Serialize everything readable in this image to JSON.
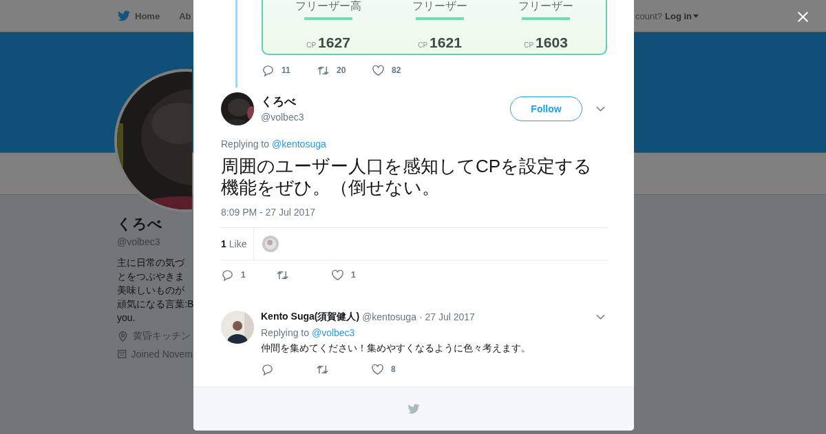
{
  "nav": {
    "items": [
      {
        "label": "Home",
        "kind": "home"
      },
      {
        "label": "Ab",
        "kind": "plain"
      }
    ],
    "account_text": "count?",
    "login": "Log in"
  },
  "profile": {
    "name": "くろべ",
    "handle": "@volbec3",
    "bio": [
      "主に日常の気づ",
      "とをつぶやきま",
      "美味しいものが",
      "頑気になる言葉:B",
      "you."
    ],
    "location": "黄昏キッチン",
    "joined": "Joined Novem"
  },
  "previous_tweet": {
    "image_labels": [
      {
        "name": "フリーザー高",
        "cp": "CP",
        "value": "1627"
      },
      {
        "name": "フリーザー",
        "cp": "CP",
        "value": "1621"
      },
      {
        "name": "フリーザー",
        "cp": "CP",
        "value": "1603"
      }
    ],
    "actions": [
      {
        "kind": "reply",
        "count": "11"
      },
      {
        "kind": "retweet",
        "count": "20"
      },
      {
        "kind": "like",
        "count": "82"
      }
    ]
  },
  "tweet": {
    "name": "くろべ",
    "handle": "@volbec3",
    "follow": "Follow",
    "replying_label": "Replying to",
    "replying_to": "@kentosuga",
    "text": "周囲のユーザー人口を感知してCPを設定する機能をぜひ。（倒せない。",
    "time": "8:09 PM - 27 Jul 2017",
    "likes_count": "1",
    "likes_label": "Like",
    "actions": [
      {
        "kind": "reply",
        "count": "1"
      },
      {
        "kind": "retweet"
      },
      {
        "kind": "like",
        "count": "1"
      }
    ]
  },
  "reply": {
    "name": "Kento Suga(須賀健人)",
    "handle": "@kentosuga",
    "date": "· 27 Jul 2017",
    "replying_label": "Replying to",
    "replying_to": "@volbec3",
    "text": "仲間を集めてください！集めやすくなるように色々考えます。",
    "actions": [
      {
        "kind": "reply"
      },
      {
        "kind": "retweet"
      },
      {
        "kind": "like",
        "count": "8"
      }
    ]
  }
}
